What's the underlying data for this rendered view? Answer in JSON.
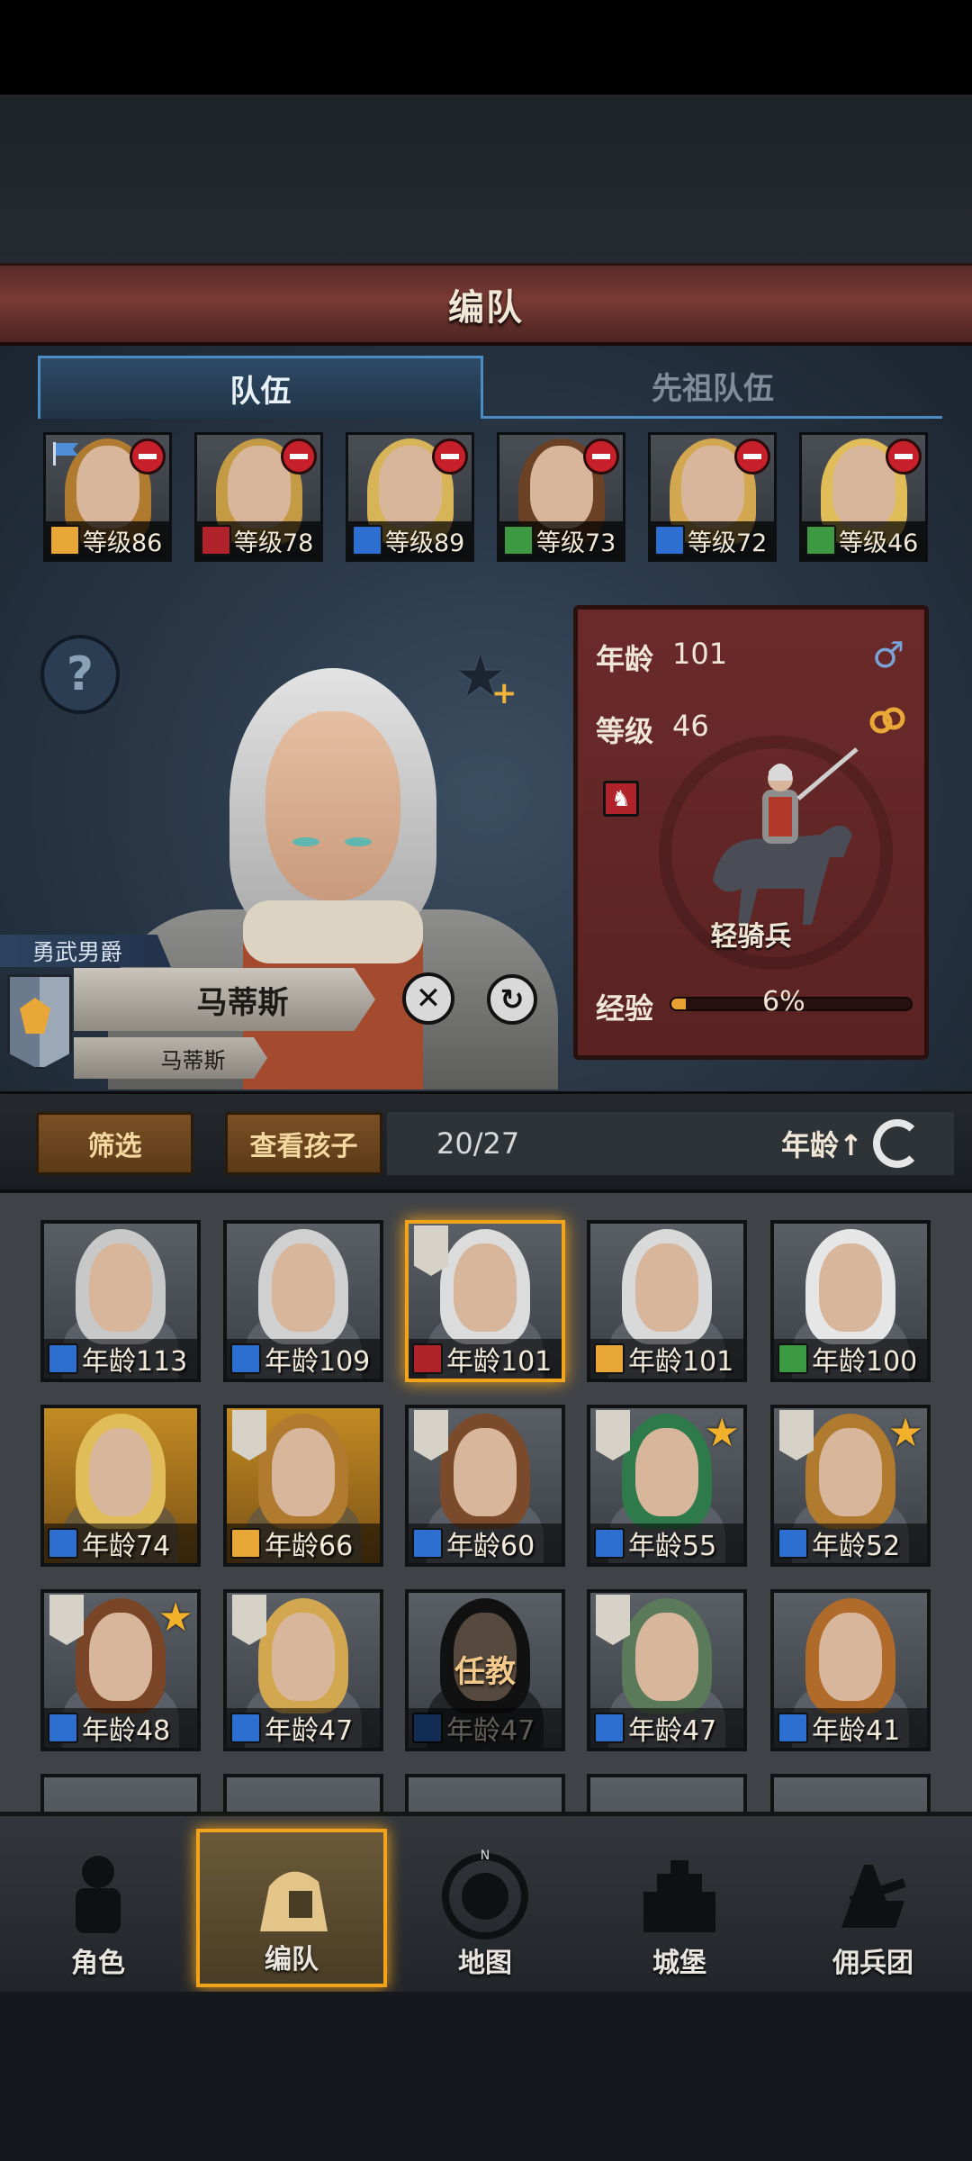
{
  "header": {
    "title": "编队"
  },
  "tabs": [
    {
      "label": "队伍",
      "active": true
    },
    {
      "label": "先祖队伍",
      "active": false
    }
  ],
  "squad": [
    {
      "level": "等级86",
      "class_icon": "shield-icon",
      "hair": "#b07a2f",
      "flag": true,
      "class_color": "#e9a737"
    },
    {
      "level": "等级78",
      "class_icon": "horse-icon",
      "hair": "#c49a45",
      "class_color": "#b1232a"
    },
    {
      "level": "等级89",
      "class_icon": "sword-icon",
      "hair": "#d8b458",
      "class_color": "#2d6fd1",
      "star": true
    },
    {
      "level": "等级73",
      "class_icon": "bow-icon",
      "hair": "#6b4126",
      "class_color": "#3c9a43"
    },
    {
      "level": "等级72",
      "class_icon": "sword-icon",
      "hair": "#d2a750",
      "class_color": "#2d6fd1"
    },
    {
      "level": "等级46",
      "class_icon": "bow-icon",
      "hair": "#e0bd59",
      "class_color": "#3c9a43"
    }
  ],
  "hero": {
    "title": "勇武男爵",
    "name": "马蒂斯",
    "subname": "马蒂斯",
    "age_label": "年龄",
    "age_value": "101",
    "level_label": "等级",
    "level_value": "46",
    "gender_icon": "male-icon",
    "unit_type": "轻骑兵",
    "exp_label": "经验",
    "exp_percent_text": "6%",
    "exp_fraction": 0.06
  },
  "toolbar": {
    "filter_label": "筛选",
    "children_label": "查看孩子",
    "count": "20/27",
    "sort_label": "年龄↑"
  },
  "roster": [
    {
      "age": "年龄113",
      "class_color": "#2d6fd1",
      "hair": "#c8c8c8",
      "bg": "grey"
    },
    {
      "age": "年龄109",
      "class_color": "#2d6fd1",
      "hair": "#d0d0d0",
      "bg": "grey"
    },
    {
      "age": "年龄101",
      "class_color": "#b1232a",
      "hair": "#dcdcdc",
      "bg": "grey",
      "selected": true,
      "banner": true
    },
    {
      "age": "年龄101",
      "class_color": "#e9a737",
      "hair": "#d9d9d9",
      "bg": "grey"
    },
    {
      "age": "年龄100",
      "class_color": "#3c9a43",
      "hair": "#e6e6e6",
      "bg": "grey"
    },
    {
      "age": "年龄74",
      "class_color": "#2d6fd1",
      "hair": "#e0bd59",
      "bg": "gold"
    },
    {
      "age": "年龄66",
      "class_color": "#e9a737",
      "hair": "#b07a2f",
      "bg": "gold",
      "banner": true
    },
    {
      "age": "年龄60",
      "class_color": "#2d6fd1",
      "hair": "#7a4a2a",
      "bg": "grey",
      "banner": true
    },
    {
      "age": "年龄55",
      "class_color": "#2d6fd1",
      "hair": "#2f7a4a",
      "bg": "grey",
      "banner": true,
      "star": true
    },
    {
      "age": "年龄52",
      "class_color": "#2d6fd1",
      "hair": "#b07a2f",
      "bg": "grey",
      "banner": true,
      "star": true
    },
    {
      "age": "年龄48",
      "class_color": "#2d6fd1",
      "hair": "#7a4526",
      "bg": "grey",
      "banner": true,
      "star": true
    },
    {
      "age": "年龄47",
      "class_color": "#2d6fd1",
      "hair": "#d2a750",
      "bg": "grey",
      "banner": true
    },
    {
      "age": "年龄47",
      "class_color": "#2d6fd1",
      "hair": "#2a2a2a",
      "bg": "grey",
      "status": "任教",
      "dim": true
    },
    {
      "age": "年龄47",
      "class_color": "#2d6fd1",
      "hair": "#5a7a5a",
      "bg": "grey",
      "banner": true
    },
    {
      "age": "年龄41",
      "class_color": "#2d6fd1",
      "hair": "#b06a2a",
      "bg": "grey"
    }
  ],
  "nav": [
    {
      "label": "角色",
      "icon": "knight-icon",
      "active": false
    },
    {
      "label": "编队",
      "icon": "helmet-icon",
      "active": true
    },
    {
      "label": "地图",
      "icon": "compass-icon",
      "active": false
    },
    {
      "label": "城堡",
      "icon": "castle-icon",
      "active": false
    },
    {
      "label": "佣兵团",
      "icon": "mercenary-icon",
      "active": false
    }
  ]
}
